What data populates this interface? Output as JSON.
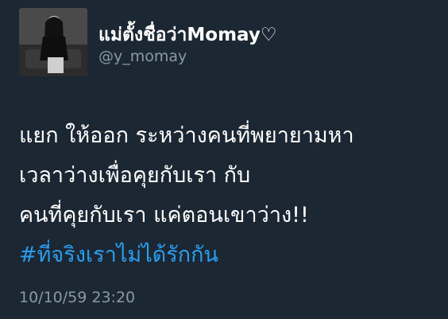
{
  "profile": {
    "display_name": "แม่ตั้งชื่อว่าMomay♡",
    "username": "@y_momay"
  },
  "tweet": {
    "lines": [
      "แยก ให้ออก ระหว่างคนที่พยายามหา",
      "เวลาว่างเพื่อคุยกับเรา กับ",
      "คนที่คุยกับเรา แค่ตอนเขาว่าง!!"
    ],
    "hashtag": "#ที่จริงเราไม่ได้รักกัน",
    "timestamp": "10/10/59 23:20"
  },
  "colors": {
    "background": "#1c2734",
    "text": "#ffffff",
    "secondary_text": "#8899a6",
    "hashtag": "#2b9ded"
  }
}
